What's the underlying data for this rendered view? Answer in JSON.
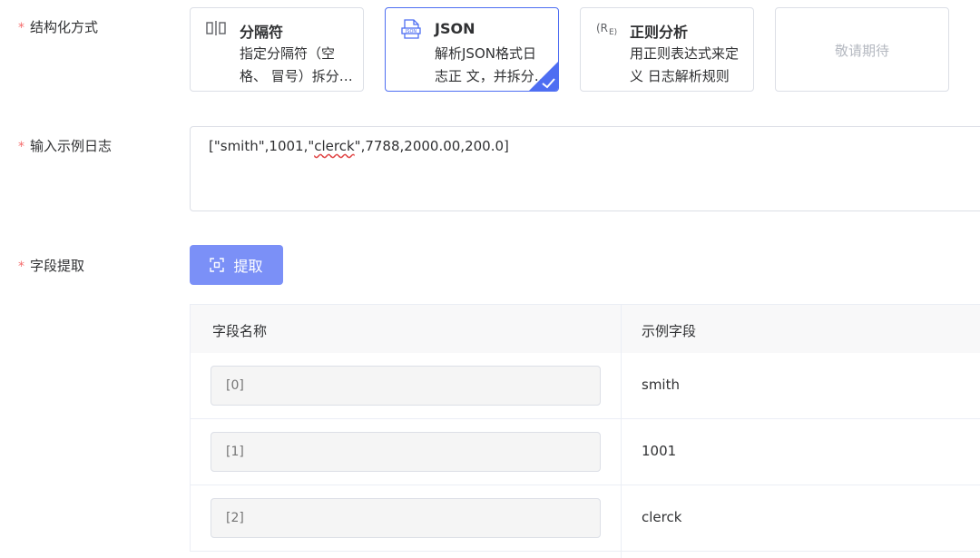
{
  "form": {
    "structure_label": "结构化方式",
    "sample_log_label": "输入示例日志",
    "field_extract_label": "字段提取",
    "required_mark": "*"
  },
  "structure_options": [
    {
      "icon": "delimiter-icon",
      "title": "分隔符",
      "desc": "指定分隔符（空格、 冒号）拆分日志",
      "selected": false
    },
    {
      "icon": "json-file-icon",
      "title": "JSON",
      "desc": "解析JSON格式日志正 文，并拆分字段",
      "selected": true
    },
    {
      "icon": "regex-icon",
      "title": "正则分析",
      "desc": "用正则表达式来定义 日志解析规则",
      "selected": false
    },
    {
      "coming_soon": "敬请期待"
    }
  ],
  "sample_log": {
    "prefix": "[\"smith\",1001,\"",
    "flagged_word": "clerck",
    "suffix": "\",7788,2000.00,200.0]"
  },
  "extract_button": {
    "label": "提取",
    "icon": "scan-icon"
  },
  "fields_table": {
    "headers": [
      "字段名称",
      "示例字段"
    ],
    "rows": [
      {
        "placeholder": "[0]",
        "sample": "smith"
      },
      {
        "placeholder": "[1]",
        "sample": "1001"
      },
      {
        "placeholder": "[2]",
        "sample": "clerck"
      }
    ]
  },
  "colors": {
    "accent": "#4e6ef2",
    "button": "#7b90f7",
    "required": "#f56c6c"
  }
}
